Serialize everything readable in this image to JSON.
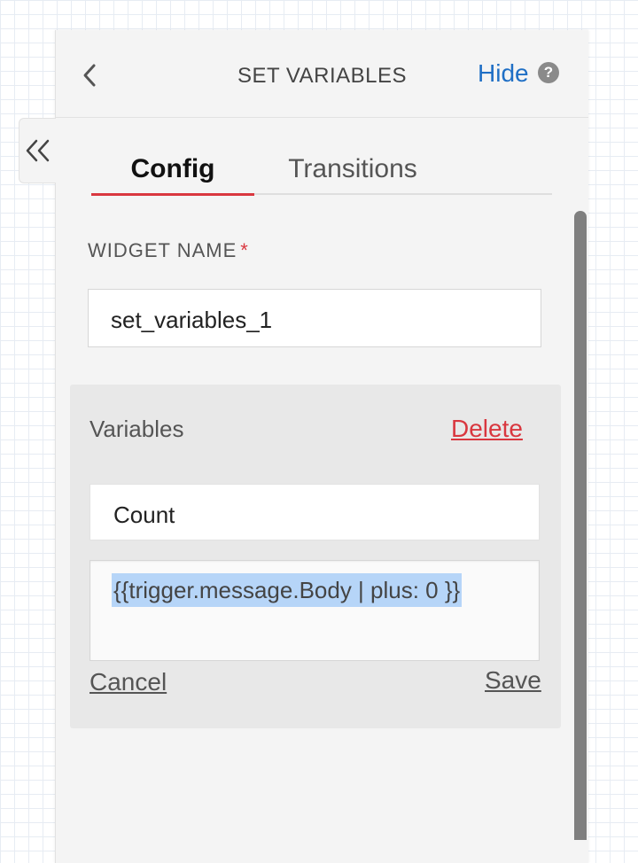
{
  "header": {
    "title": "SET VARIABLES",
    "hide_label": "Hide",
    "help_glyph": "?"
  },
  "tabs": [
    {
      "label": "Config",
      "active": true
    },
    {
      "label": "Transitions",
      "active": false
    }
  ],
  "widget_name": {
    "label": "WIDGET NAME",
    "required_marker": "*",
    "value": "set_variables_1"
  },
  "variables": {
    "title": "Variables",
    "delete_label": "Delete",
    "key_value": "Count",
    "value_value": "{{trigger.message.Body | plus: 0 }}",
    "cancel_label": "Cancel",
    "save_label": "Save"
  },
  "icons": {
    "back": "chevron-left-icon",
    "collapse": "double-chevron-left-icon",
    "help": "question-circle-icon"
  },
  "colors": {
    "accent_red": "#d9373f",
    "link_blue": "#1f6fc5",
    "selection": "#b6d5f8"
  }
}
